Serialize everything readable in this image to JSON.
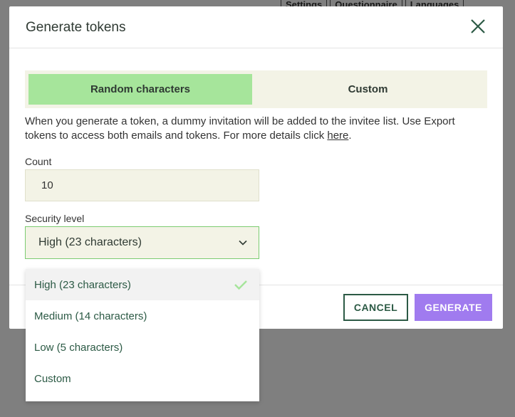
{
  "background": {
    "breadcrumbs": [
      "Settings",
      "Questionnaire",
      "Languages"
    ]
  },
  "modal": {
    "title": "Generate tokens",
    "tabs": [
      {
        "label": "Random characters",
        "active": true
      },
      {
        "label": "Custom",
        "active": false
      }
    ],
    "description_text": "When you generate a token, a dummy invitation will be added to the invitee list. Use Export tokens to access both emails and tokens. For more details click ",
    "description_link": "here",
    "description_end": ".",
    "count_label": "Count",
    "count_value": "10",
    "security_label": "Security level",
    "security_selected": "High (23 characters)",
    "security_options": [
      {
        "label": "High (23 characters)",
        "selected": true
      },
      {
        "label": "Medium (14 characters)",
        "selected": false
      },
      {
        "label": "Low (5 characters)",
        "selected": false
      },
      {
        "label": "Custom",
        "selected": false
      }
    ],
    "cancel_label": "CANCEL",
    "generate_label": "GENERATE"
  },
  "icons": {
    "close": "close-icon",
    "chevron": "chevron-down-icon",
    "check": "check-icon"
  },
  "colors": {
    "active_tab": "#a6e59b",
    "input_bg": "#f3f3e6",
    "generate_bg": "#a07bef",
    "cancel_border": "#2c5a45",
    "check": "#a6e59b"
  }
}
